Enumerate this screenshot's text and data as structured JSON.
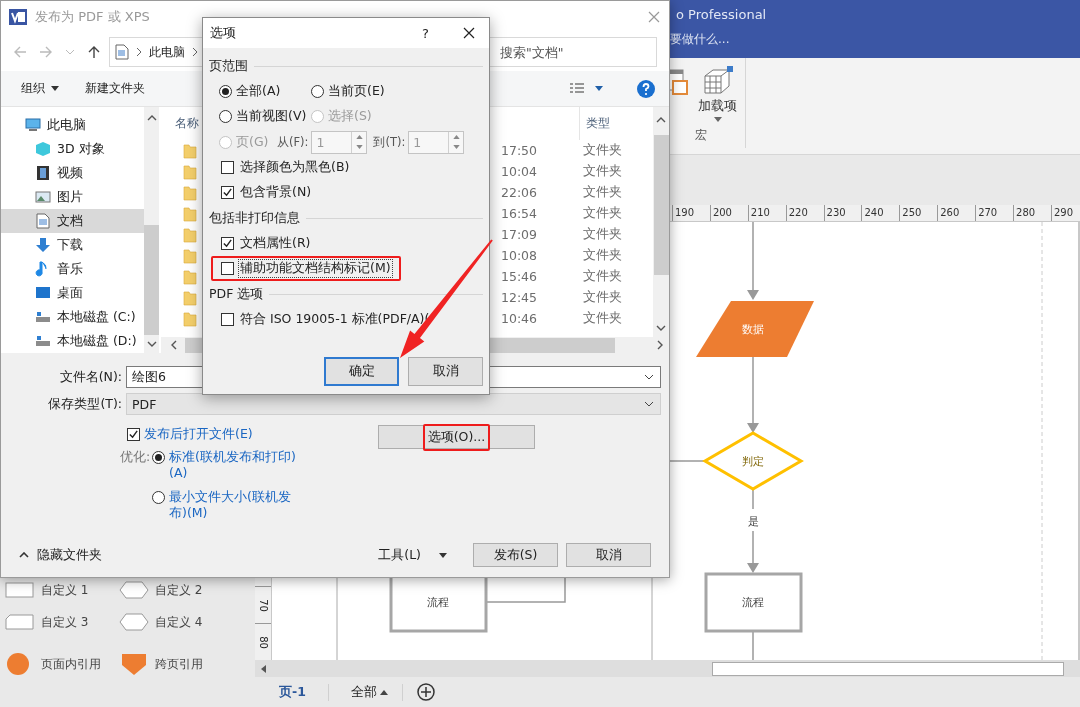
{
  "visio": {
    "title": "o Professional",
    "tell_me": "要做什么...",
    "addins_button": "加载项",
    "group_label": "宏",
    "ruler_ticks": [
      "190",
      "200",
      "210",
      "220",
      "230",
      "240",
      "250",
      "260",
      "270",
      "280",
      "290"
    ],
    "vruler_ticks": [
      "70",
      "80"
    ],
    "shapes": [
      {
        "kind": "rect",
        "label": "自定义 1"
      },
      {
        "kind": "hexagon",
        "label": "自定义 2"
      },
      {
        "kind": "tab",
        "label": "自定义 3"
      },
      {
        "kind": "hexagon",
        "label": "自定义 4"
      },
      {
        "kind": "circle",
        "label": "页面内引用"
      },
      {
        "kind": "pentagon",
        "label": "跨页引用"
      }
    ],
    "flowchart": {
      "nodes": [
        {
          "kind": "data",
          "label": "数据"
        },
        {
          "kind": "decision",
          "label": "判定"
        },
        {
          "kind": "process",
          "label": "流程"
        },
        {
          "kind": "process",
          "label": "流程"
        }
      ],
      "edge_labels": [
        "是"
      ]
    },
    "page_tabs": [
      {
        "label": "页-1",
        "selected": true
      }
    ],
    "all_pages": "全部"
  },
  "save_dialog": {
    "title": "发布为 PDF 或 XPS",
    "breadcrumb": "此电脑",
    "search_placeholder": "搜索\"文档\"",
    "organize": "组织",
    "new_folder": "新建文件夹",
    "nav": [
      {
        "label": "此电脑",
        "kind": "computer",
        "selected": false,
        "children": [
          {
            "label": "3D 对象",
            "kind": "cube",
            "selected": false
          },
          {
            "label": "视频",
            "kind": "film",
            "selected": false
          },
          {
            "label": "图片",
            "kind": "image",
            "selected": false
          },
          {
            "label": "文档",
            "kind": "document",
            "selected": true
          },
          {
            "label": "下载",
            "kind": "download",
            "selected": false
          },
          {
            "label": "音乐",
            "kind": "music",
            "selected": false
          },
          {
            "label": "桌面",
            "kind": "desktop",
            "selected": false
          },
          {
            "label": "本地磁盘 (C:)",
            "kind": "drive",
            "selected": false
          },
          {
            "label": "本地磁盘 (D:)",
            "kind": "drive",
            "selected": false
          }
        ]
      }
    ],
    "columns": [
      "名称",
      "类型"
    ],
    "rows": [
      {
        "column_2": "17:50",
        "type": "文件夹"
      },
      {
        "column_2": "10:04",
        "type": "文件夹"
      },
      {
        "column_2": "22:06",
        "type": "文件夹"
      },
      {
        "column_2": "16:54",
        "type": "文件夹"
      },
      {
        "column_2": "17:09",
        "type": "文件夹"
      },
      {
        "column_2": "10:08",
        "type": "文件夹"
      },
      {
        "column_2": "15:46",
        "type": "文件夹"
      },
      {
        "column_2": "12:45",
        "type": "文件夹"
      },
      {
        "column_2": "10:46",
        "type": "文件夹"
      }
    ],
    "file_name": {
      "label": "文件名(N):",
      "value": "绘图6"
    },
    "save_type": {
      "label": "保存类型(T):",
      "value": "PDF"
    },
    "open_after": {
      "label": "发布后打开文件(E)",
      "checked": true
    },
    "options_button": {
      "label": "选项(O)...",
      "highlighted": true
    },
    "optimize": {
      "label": "优化:",
      "options": [
        {
          "label": "标准(联机发布和打印)(A)",
          "selected": true
        },
        {
          "label": "最小文件大小(联机发布)(M)",
          "selected": false
        }
      ]
    },
    "hide_folders": "隐藏文件夹",
    "tools": "工具(L)",
    "publish": "发布(S)",
    "cancel": "取消"
  },
  "options_dialog": {
    "title": "选项",
    "help": "?",
    "page_range": {
      "title": "页范围",
      "radios": [
        {
          "label": "全部(A)",
          "selected": true,
          "disabled": false
        },
        {
          "label": "当前页(E)",
          "selected": false,
          "disabled": false
        },
        {
          "label": "当前视图(V)",
          "selected": false,
          "disabled": false
        },
        {
          "label": "选择(S)",
          "selected": false,
          "disabled": true
        },
        {
          "label": "页(G)",
          "selected": false,
          "disabled": true
        }
      ],
      "from": {
        "label": "从(F):",
        "value": "1",
        "disabled": true
      },
      "to": {
        "label": "到(T):",
        "value": "1",
        "disabled": true
      }
    },
    "print_checks": [
      {
        "label": "选择颜色为黑色(B)",
        "checked": false,
        "highlighted": false,
        "focused": false
      },
      {
        "label": "包含背景(N)",
        "checked": true,
        "highlighted": false,
        "focused": false
      }
    ],
    "nonprint": {
      "title": "包括非打印信息",
      "items": [
        {
          "label": "文档属性(R)",
          "checked": true,
          "highlighted": false,
          "focused": false
        },
        {
          "label": "辅助功能文档结构标记(M)",
          "checked": false,
          "highlighted": true,
          "focused": true
        }
      ]
    },
    "pdf": {
      "title": "PDF 选项",
      "items": [
        {
          "label": "符合 ISO 19005-1 标准(PDF/A)(",
          "checked": false,
          "highlighted": false,
          "focused": false
        }
      ]
    },
    "buttons": [
      {
        "label": "确定",
        "default": true
      },
      {
        "label": "取消",
        "default": false
      }
    ]
  },
  "annotations": [
    {
      "kind": "arrow"
    }
  ]
}
